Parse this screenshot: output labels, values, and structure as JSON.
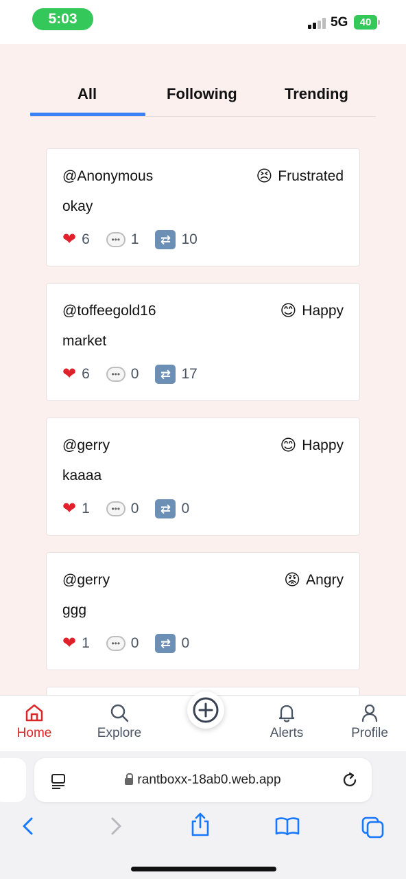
{
  "status_bar": {
    "time": "5:03",
    "network": "5G",
    "battery": "40"
  },
  "tabs": [
    {
      "label": "All",
      "active": true
    },
    {
      "label": "Following",
      "active": false
    },
    {
      "label": "Trending",
      "active": false
    }
  ],
  "posts": [
    {
      "user": "@Anonymous",
      "mood_emoji": "😣",
      "mood": "Frustrated",
      "text": "okay",
      "likes": "6",
      "comments": "1",
      "reposts": "10"
    },
    {
      "user": "@toffeegold16",
      "mood_emoji": "😊",
      "mood": "Happy",
      "text": "market",
      "likes": "6",
      "comments": "0",
      "reposts": "17"
    },
    {
      "user": "@gerry",
      "mood_emoji": "😊",
      "mood": "Happy",
      "text": "kaaaa",
      "likes": "1",
      "comments": "0",
      "reposts": "0"
    },
    {
      "user": "@gerry",
      "mood_emoji": "😡",
      "mood": "Angry",
      "text": "ggg",
      "likes": "1",
      "comments": "0",
      "reposts": "0"
    }
  ],
  "nav": {
    "home": "Home",
    "explore": "Explore",
    "alerts": "Alerts",
    "profile": "Profile"
  },
  "browser": {
    "url": "rantboxx-18ab0.web.app"
  },
  "colors": {
    "accent": "#3b82f6",
    "home_active": "#dc2626",
    "background": "#fbf0ee"
  }
}
